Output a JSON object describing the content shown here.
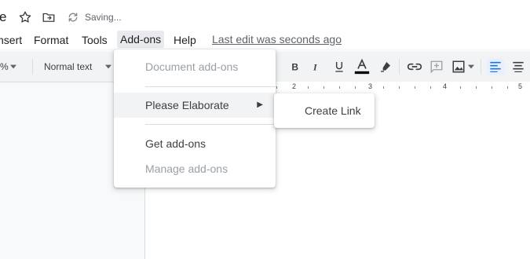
{
  "title_bar": {
    "doc_title_fragment": "e",
    "saving_text": "Saving..."
  },
  "menubar": {
    "items": [
      "nsert",
      "Format",
      "Tools",
      "Add-ons",
      "Help"
    ],
    "last_edit": "Last edit was seconds ago"
  },
  "toolbar": {
    "zoom_fragment": "%",
    "style_select": "Normal text"
  },
  "ruler": {
    "numbers": [
      "2",
      "3",
      "4",
      "5"
    ]
  },
  "addons_menu": {
    "document_addons": "Document add-ons",
    "please_elaborate": "Please Elaborate",
    "get_addons": "Get add-ons",
    "manage_addons": "Manage add-ons",
    "submenu_arrow": "▶"
  },
  "submenu": {
    "create_link": "Create Link"
  },
  "colors": {
    "accent": "#1a73e8",
    "text_color_bar": "#000000"
  }
}
